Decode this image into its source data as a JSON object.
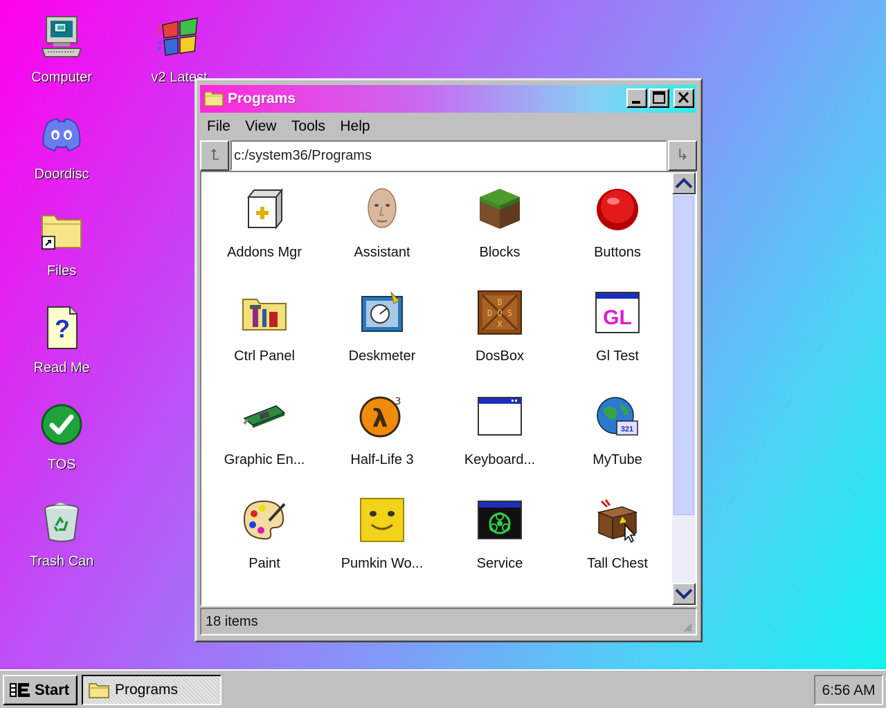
{
  "desktop": {
    "icons": [
      {
        "label": "Computer",
        "icon": "computer-icon"
      },
      {
        "label": "v2 Latest",
        "icon": "windows-logo-icon"
      },
      {
        "label": "Doordisc",
        "icon": "discord-icon"
      },
      {
        "label": "Files",
        "icon": "folder-shortcut-icon"
      },
      {
        "label": "Read Me",
        "icon": "help-document-icon"
      },
      {
        "label": "TOS",
        "icon": "checkmark-icon"
      },
      {
        "label": "Trash Can",
        "icon": "recycle-bin-icon"
      }
    ]
  },
  "window": {
    "title": "Programs",
    "menu": [
      "File",
      "View",
      "Tools",
      "Help"
    ],
    "address": "c:/system36/Programs",
    "items": [
      {
        "label": "Addons Mgr",
        "icon": "addons-box-icon"
      },
      {
        "label": "Assistant",
        "icon": "face-icon"
      },
      {
        "label": "Blocks",
        "icon": "grass-block-icon"
      },
      {
        "label": "Buttons",
        "icon": "red-button-icon"
      },
      {
        "label": "Ctrl Panel",
        "icon": "control-panel-folder-icon"
      },
      {
        "label": "Deskmeter",
        "icon": "deskmeter-icon"
      },
      {
        "label": "DosBox",
        "icon": "dosbox-icon"
      },
      {
        "label": "Gl Test",
        "icon": "gl-window-icon"
      },
      {
        "label": "Graphic En...",
        "icon": "graphics-card-icon"
      },
      {
        "label": "Half-Life 3",
        "icon": "half-life-icon"
      },
      {
        "label": "Keyboard...",
        "icon": "window-icon"
      },
      {
        "label": "MyTube",
        "icon": "mytube-globe-icon"
      },
      {
        "label": "Paint",
        "icon": "palette-icon"
      },
      {
        "label": "Pumkin Wo...",
        "icon": "yellow-face-icon"
      },
      {
        "label": "Service",
        "icon": "biohazard-window-icon"
      },
      {
        "label": "Tall Chest",
        "icon": "chest-icon"
      }
    ],
    "status": "18 items"
  },
  "taskbar": {
    "start_label": "Start",
    "tasks": [
      {
        "label": "Programs",
        "icon": "folder-icon"
      }
    ],
    "clock": "6:56 AM"
  },
  "colors": {
    "desktop_gradient_start": "#ff00ee",
    "desktop_gradient_end": "#14f2ee",
    "titlebar_start": "#ff28d9",
    "titlebar_end": "#27f0ec",
    "chrome": "#c0c0c0"
  }
}
